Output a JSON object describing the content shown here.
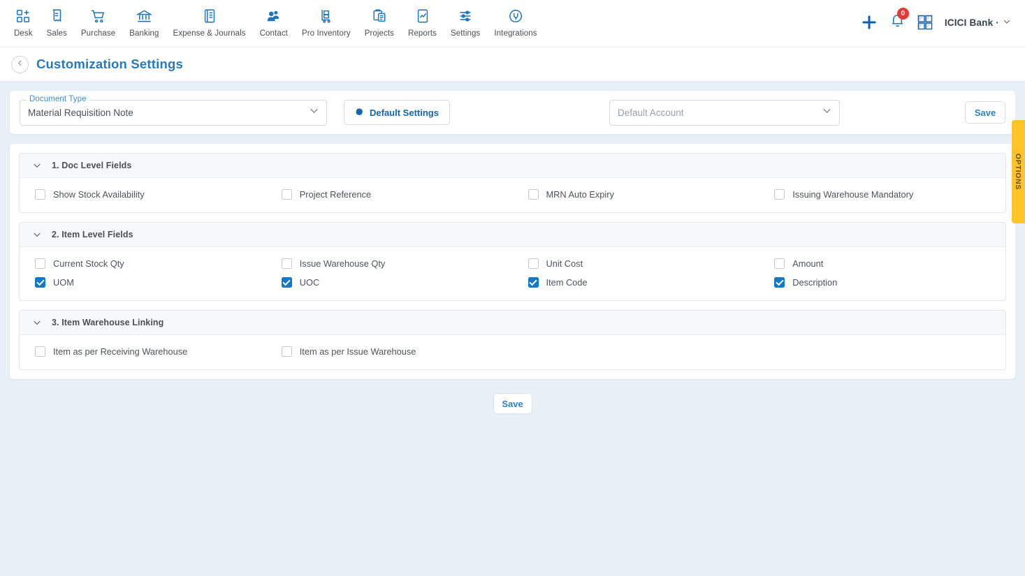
{
  "topnav": {
    "items": [
      {
        "label": "Desk",
        "icon": "desk-grid-plus-icon"
      },
      {
        "label": "Sales",
        "icon": "sales-receipt-icon"
      },
      {
        "label": "Purchase",
        "icon": "purchase-cart-icon"
      },
      {
        "label": "Banking",
        "icon": "banking-bank-icon"
      },
      {
        "label": "Expense & Journals",
        "icon": "expense-journal-icon"
      },
      {
        "label": "Contact",
        "icon": "contact-people-icon"
      },
      {
        "label": "Pro Inventory",
        "icon": "pro-inventory-trolley-icon"
      },
      {
        "label": "Projects",
        "icon": "projects-clipboard-icon"
      },
      {
        "label": "Reports",
        "icon": "reports-chart-icon"
      },
      {
        "label": "Settings",
        "icon": "settings-sliders-icon"
      },
      {
        "label": "Integrations",
        "icon": "integrations-plug-icon"
      }
    ],
    "add_icon": "plus-icon",
    "notifications_icon": "bell-icon",
    "notifications_count": "0",
    "apps_icon": "grid-apps-icon",
    "org_name": "ICICI Bank ·",
    "org_caret_icon": "chevron-down-icon"
  },
  "header": {
    "back_icon": "chevron-left-icon",
    "title": "Customization Settings"
  },
  "toolbar": {
    "document_type_label": "Document Type",
    "document_type_value": "Material Requisition Note",
    "document_type_caret": "chevron-down-icon",
    "default_settings_label": "Default Settings",
    "default_settings_icon": "gear-icon",
    "default_account_placeholder": "Default Account",
    "default_account_caret": "chevron-down-icon",
    "save_label": "Save"
  },
  "sections": [
    {
      "title": "1. Doc Level Fields",
      "chevron_icon": "chevron-down-icon",
      "rows": [
        [
          {
            "label": "Show Stock Availability",
            "checked": false
          },
          {
            "label": "Project Reference",
            "checked": false
          },
          {
            "label": "MRN Auto Expiry",
            "checked": false
          },
          {
            "label": "Issuing Warehouse Mandatory",
            "checked": false
          }
        ]
      ]
    },
    {
      "title": "2. Item Level Fields",
      "chevron_icon": "chevron-down-icon",
      "rows": [
        [
          {
            "label": "Current Stock Qty",
            "checked": false
          },
          {
            "label": "Issue Warehouse Qty",
            "checked": false
          },
          {
            "label": "Unit Cost",
            "checked": false
          },
          {
            "label": "Amount",
            "checked": false
          }
        ],
        [
          {
            "label": "UOM",
            "checked": true
          },
          {
            "label": "UOC",
            "checked": true
          },
          {
            "label": "Item Code",
            "checked": true
          },
          {
            "label": "Description",
            "checked": true
          }
        ]
      ]
    },
    {
      "title": "3. Item Warehouse Linking",
      "chevron_icon": "chevron-down-icon",
      "rows": [
        [
          {
            "label": "Item as per Receiving Warehouse",
            "checked": false
          },
          {
            "label": "Item as per Issue Warehouse",
            "checked": false
          }
        ]
      ]
    }
  ],
  "footer": {
    "save_label": "Save"
  },
  "options_tab": {
    "label": "OPTIONS"
  },
  "colors": {
    "page_background": "#e9eff7",
    "accent_blue": "#1d76bd",
    "title_blue": "#2a7ab9",
    "checkbox_checked": "#1478c9",
    "badge_red": "#e53935",
    "options_yellow": "#fdc327"
  }
}
